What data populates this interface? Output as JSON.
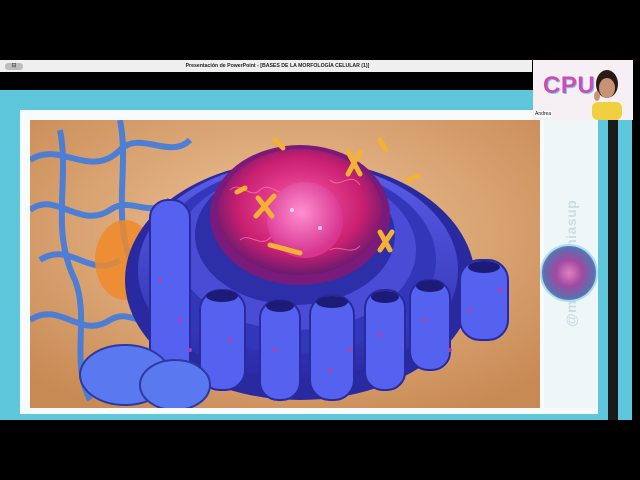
{
  "window": {
    "title": "Presentación de PowerPoint - [BASES DE LA MORFOLOGÍA CELULAR (1)]",
    "icon": "window-icon"
  },
  "slide": {
    "image": "cell-organelle-illustration",
    "side_handle": "@medecpuniasup"
  },
  "webcam": {
    "logo_text": "CPU",
    "participant_name": "Andrea"
  },
  "colors": {
    "slide_frame": "#5fc7dc",
    "logo": "#d24bb4",
    "nucleus": "#d8358f",
    "er": "#3d3fc9"
  }
}
